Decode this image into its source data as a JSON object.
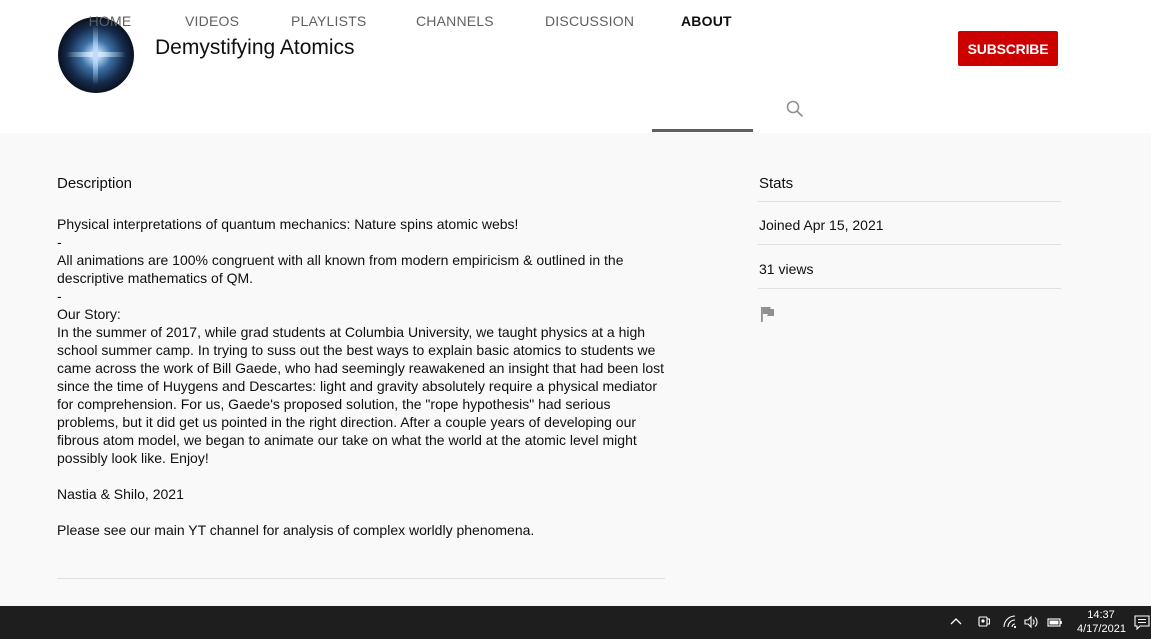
{
  "channel": {
    "name": "Demystifying Atomics",
    "subscribe_label": "SUBSCRIBE"
  },
  "tabs": [
    {
      "label": "HOME"
    },
    {
      "label": "VIDEOS"
    },
    {
      "label": "PLAYLISTS"
    },
    {
      "label": "CHANNELS"
    },
    {
      "label": "DISCUSSION"
    },
    {
      "label": "ABOUT"
    }
  ],
  "active_tab": "ABOUT",
  "description": {
    "heading": "Description",
    "paragraphs": [
      "Physical interpretations of quantum mechanics: Nature spins atomic webs!",
      "-",
      "All animations are 100% congruent with all known from modern empiricism & outlined in the descriptive mathematics of QM.",
      "-",
      "Our Story:",
      "In the summer of 2017, while grad students at Columbia University, we taught physics at a high school summer camp. In trying to suss out the best ways to explain basic atomics to students we came across the work of Bill Gaede, who had seemingly reawakened an insight that had been lost since the time of Huygens and Descartes: light and gravity absolutely require a physical mediator for comprehension. For us, Gaede's proposed solution, the \"rope hypothesis\" had serious problems, but it did get us pointed in the right direction. After a couple years of developing our fibrous atom model, we began to animate our take on what the world at the atomic level might possibly look like. Enjoy!",
      "Nastia & Shilo, 2021",
      "Please see our main YT channel for analysis of complex worldly phenomena."
    ]
  },
  "stats": {
    "heading": "Stats",
    "joined": "Joined Apr 15, 2021",
    "views": "31 views"
  },
  "taskbar": {
    "time": "14:37",
    "date": "4/17/2021"
  },
  "colors": {
    "subscribe": "#cc0000",
    "taskbar": "#1e1e1e",
    "page_background": "#f9f9f9"
  },
  "icons": {
    "search_tab": "search-icon",
    "report": "flag-icon",
    "tray": [
      "chevron-up-icon",
      "meet-now-icon",
      "wifi-icon",
      "volume-icon",
      "battery-icon"
    ],
    "notifications": "notification-icon"
  }
}
